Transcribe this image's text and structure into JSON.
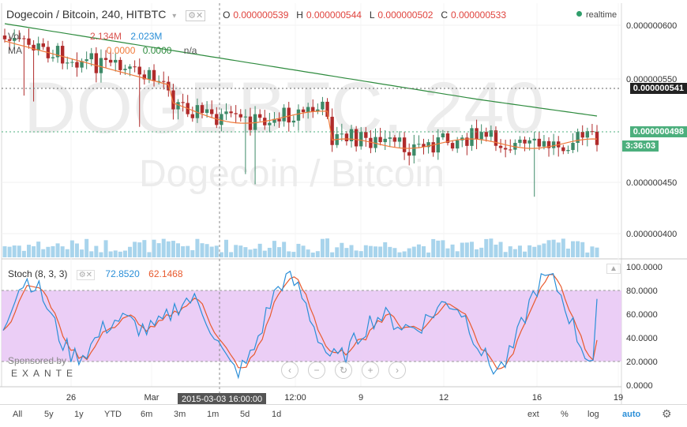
{
  "header": {
    "title": "Dogecoin / Bitcoin, 240, HITBTC",
    "o_label": "O",
    "o_value": "0.000000539",
    "h_label": "H",
    "h_value": "0.000000544",
    "l_label": "L",
    "l_value": "0.000000502",
    "c_label": "C",
    "c_value": "0.000000533",
    "realtime": "realtime",
    "vol_values": [
      "2.134M",
      "2.023M"
    ],
    "ma_label": "MA",
    "ma_values": [
      "0.0000",
      "0.0000",
      "n/a"
    ]
  },
  "watermark": {
    "big": "DOGEBTC, 240",
    "sub": "Dogecoin / Bitcoin"
  },
  "price_axis": {
    "ticks": [
      "0.000000600",
      "0.000000550",
      "0.000000450",
      "0.000000400"
    ],
    "markers": [
      {
        "value": "0.000000541",
        "bg": "#222222"
      },
      {
        "value": "0.000000498",
        "bg": "#4caf7d"
      },
      {
        "value": "3:36:03",
        "bg": "#4caf7d"
      }
    ]
  },
  "stoch": {
    "label": "Stoch (8, 3, 3)",
    "k_value": "72.8520",
    "d_value": "62.1468",
    "k_color": "#2b8fd8",
    "d_color": "#e85a2e",
    "axis_ticks": [
      "100.0000",
      "80.0000",
      "60.0000",
      "40.0000",
      "20.0000",
      "0.0000"
    ]
  },
  "sponsor": {
    "label": "Sponsored by",
    "brand": "EXANTE"
  },
  "time_axis": {
    "labels": [
      "26",
      "Mar",
      "12:00",
      "9",
      "12",
      "16",
      "19"
    ],
    "cursor_label": "2015-03-03 16:00:00"
  },
  "toolbar": {
    "ranges": [
      "All",
      "5y",
      "1y",
      "YTD",
      "6m",
      "3m",
      "1m",
      "5d",
      "1d"
    ],
    "right": [
      "ext",
      "%",
      "log",
      "auto"
    ]
  },
  "colors": {
    "up": "#3d8a68",
    "down": "#b02b2b",
    "ma_fast": "#f07a3a",
    "ma_slow": "#2e8b3e",
    "volume": "#a8d4ec",
    "stoch_band": "#e9c9f5"
  }
}
